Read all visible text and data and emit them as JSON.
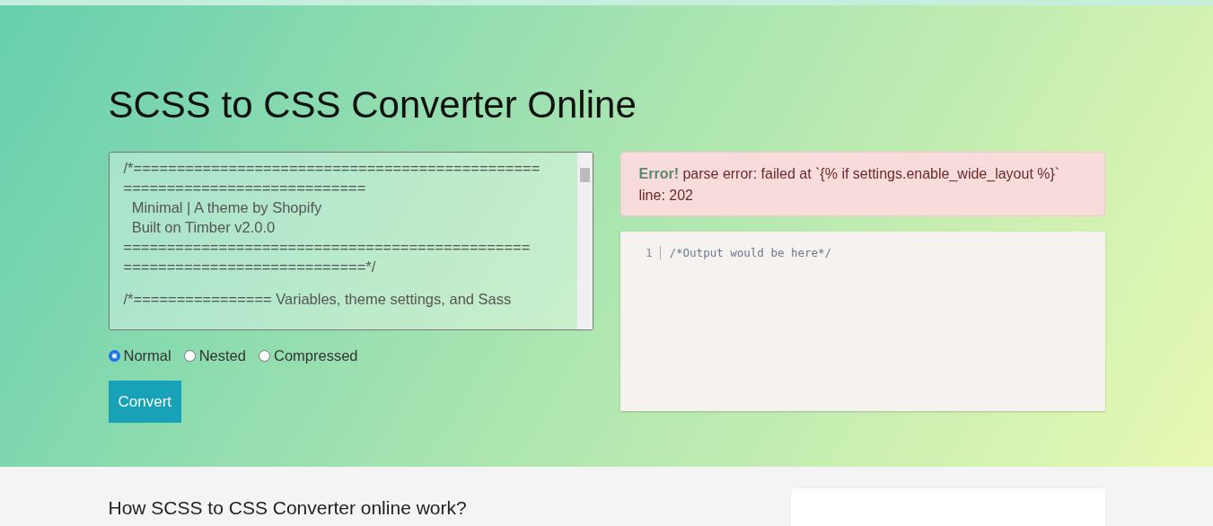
{
  "title": "SCSS to CSS Converter Online",
  "input": {
    "blocks": [
      [
        "/*===============================================",
        "============================",
        "  Minimal | A theme by Shopify",
        "  Built on Timber v2.0.0",
        "===============================================",
        "============================*/"
      ],
      [
        "/*================ Variables, theme settings, and Sass"
      ]
    ]
  },
  "styles": [
    {
      "label": "Normal",
      "selected": true
    },
    {
      "label": "Nested",
      "selected": false
    },
    {
      "label": "Compressed",
      "selected": false
    }
  ],
  "convert_button": "Convert",
  "error": {
    "label": "Error!",
    "message": "parse error: failed at `{% if settings.enable_wide_layout %}` line: 202"
  },
  "output": {
    "lines": [
      {
        "number": "1",
        "text": "/*Output would be here*/"
      }
    ]
  },
  "section_heading": "How SCSS to CSS Converter online work?"
}
